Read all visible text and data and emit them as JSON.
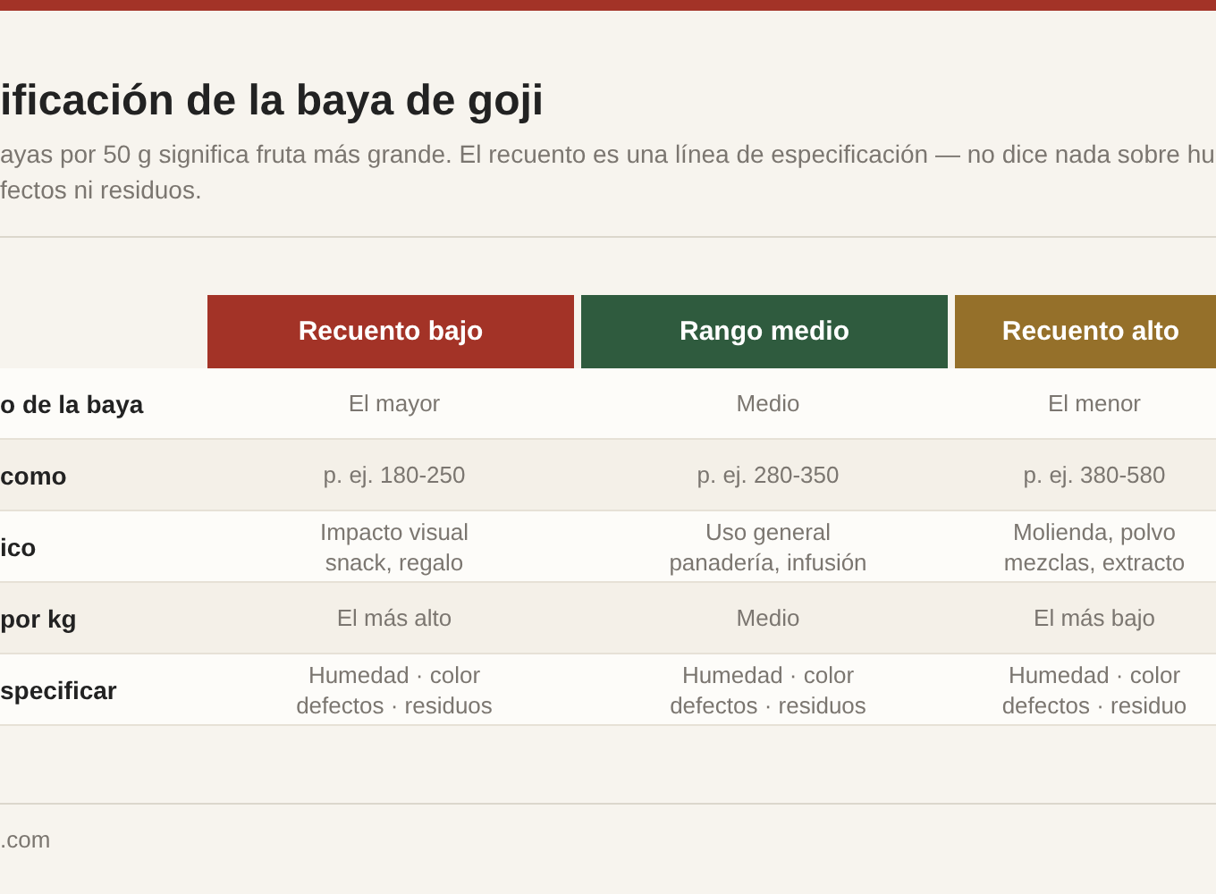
{
  "title": "ificación de la baya de goji",
  "description": "ayas por 50 g significa fruta más grande. El recuento es una línea de especificación — no dice nada sobre hu\nfectos ni residuos.",
  "table": {
    "columns": [
      {
        "label": "Recuento bajo",
        "color": "#a33327"
      },
      {
        "label": "Rango medio",
        "color": "#2f5b3e"
      },
      {
        "label": "Recuento alto",
        "color": "#95702a"
      }
    ],
    "rows": [
      {
        "label": "o de la baya",
        "cells": [
          "El mayor",
          "Medio",
          "El menor"
        ]
      },
      {
        "label": "como",
        "cells": [
          "p. ej. 180-250",
          "p. ej. 280-350",
          "p. ej. 380-580"
        ]
      },
      {
        "label": "ico",
        "cells": [
          "Impacto visual\nsnack, regalo",
          "Uso general\npanadería, infusión",
          "Molienda, polvo\nmezclas, extracto"
        ]
      },
      {
        "label": "por kg",
        "cells": [
          "El más alto",
          "Medio",
          "El más bajo"
        ]
      },
      {
        "label": "specificar",
        "cells": [
          "Humedad · color\ndefectos · residuos",
          "Humedad · color\ndefectos · residuos",
          "Humedad · color\ndefectos · residuo"
        ]
      }
    ]
  },
  "footer": ".com"
}
